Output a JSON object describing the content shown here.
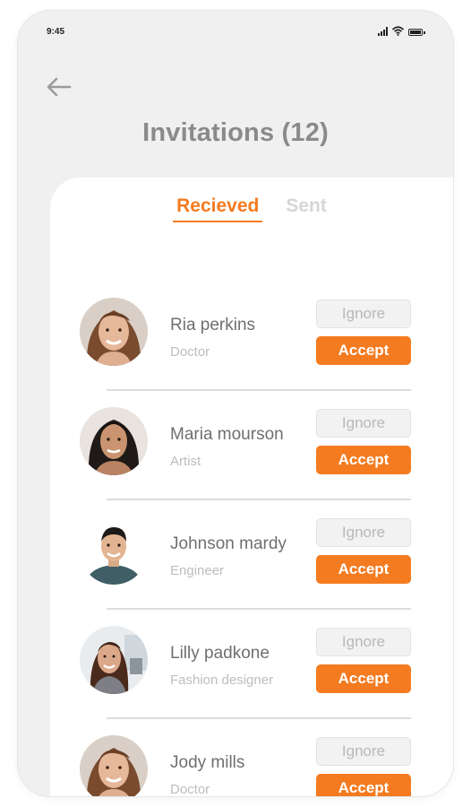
{
  "status_bar": {
    "time": "9:45"
  },
  "header": {
    "title": "Invitations (12)",
    "back_icon": "arrow-left-icon"
  },
  "tabs": [
    {
      "label": "Recieved",
      "active": true
    },
    {
      "label": "Sent",
      "active": false
    }
  ],
  "actions": {
    "ignore_label": "Ignore",
    "accept_label": "Accept"
  },
  "invitations": [
    {
      "name": "Ria perkins",
      "role": "Doctor",
      "avatar": "woman-smiling-avatar"
    },
    {
      "name": "Maria mourson",
      "role": "Artist",
      "avatar": "woman-dark-hair-avatar"
    },
    {
      "name": "Johnson mardy",
      "role": "Engineer",
      "avatar": "man-smiling-avatar"
    },
    {
      "name": "Lilly padkone",
      "role": "Fashion designer",
      "avatar": "woman-office-avatar"
    },
    {
      "name": "Jody mills",
      "role": "Doctor",
      "avatar": "woman-smiling-avatar"
    }
  ],
  "colors": {
    "accent": "#f47b20",
    "background": "#f0f0f0",
    "card": "#ffffff",
    "title": "#8a8a8a",
    "ignore_bg": "#f2f2f2"
  }
}
